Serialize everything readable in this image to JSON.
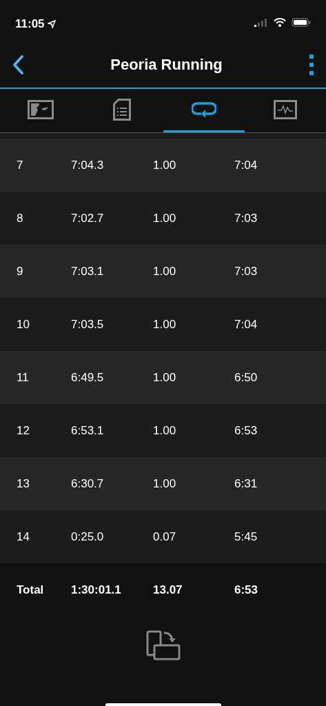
{
  "status_bar": {
    "time": "11:05"
  },
  "nav": {
    "title": "Peoria Running"
  },
  "tabs": [
    {
      "kind": "map",
      "selected": false
    },
    {
      "kind": "details",
      "selected": false
    },
    {
      "kind": "laps",
      "selected": true
    },
    {
      "kind": "chart",
      "selected": false
    }
  ],
  "laps": [
    {
      "lap": "7",
      "time": "7:04.3",
      "distance": "1.00",
      "pace": "7:04"
    },
    {
      "lap": "8",
      "time": "7:02.7",
      "distance": "1.00",
      "pace": "7:03"
    },
    {
      "lap": "9",
      "time": "7:03.1",
      "distance": "1.00",
      "pace": "7:03"
    },
    {
      "lap": "10",
      "time": "7:03.5",
      "distance": "1.00",
      "pace": "7:04"
    },
    {
      "lap": "11",
      "time": "6:49.5",
      "distance": "1.00",
      "pace": "6:50"
    },
    {
      "lap": "12",
      "time": "6:53.1",
      "distance": "1.00",
      "pace": "6:53"
    },
    {
      "lap": "13",
      "time": "6:30.7",
      "distance": "1.00",
      "pace": "6:31"
    },
    {
      "lap": "14",
      "time": "0:25.0",
      "distance": "0.07",
      "pace": "5:45"
    }
  ],
  "total": {
    "label": "Total",
    "time": "1:30:01.1",
    "distance": "13.07",
    "pace": "6:53"
  }
}
